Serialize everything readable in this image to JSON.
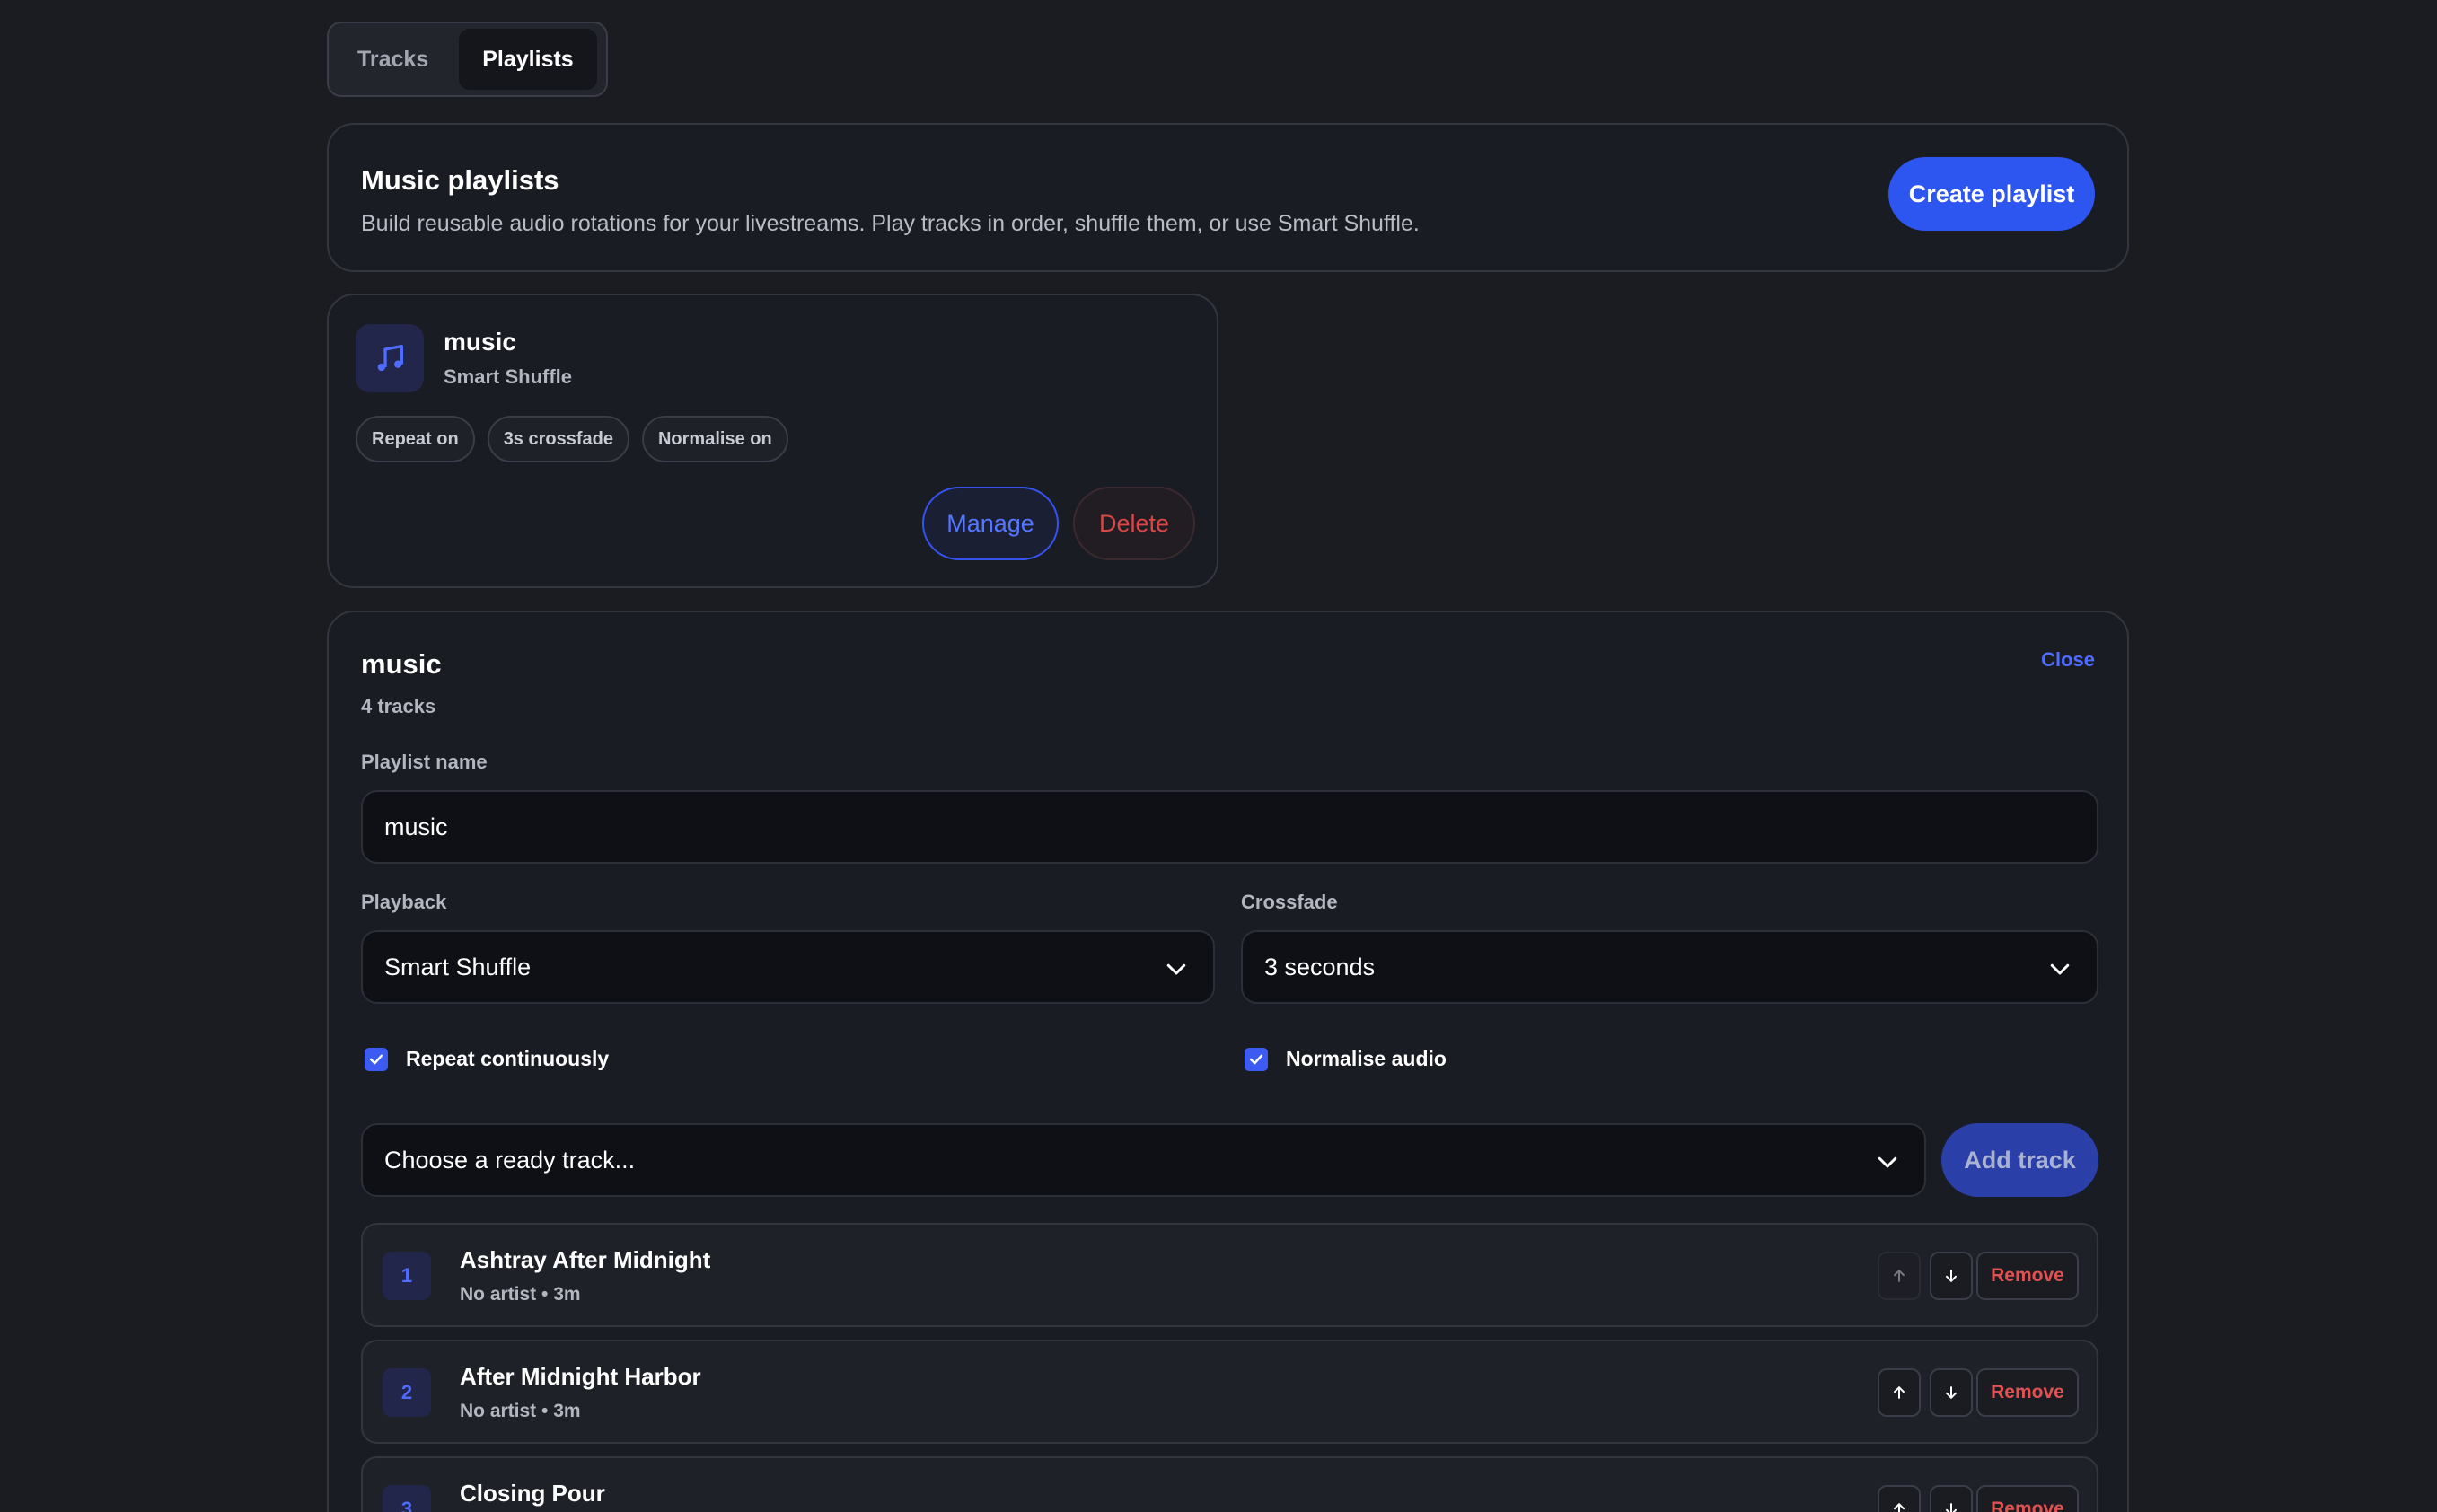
{
  "tabs": [
    {
      "label": "Tracks",
      "active": false
    },
    {
      "label": "Playlists",
      "active": true
    }
  ],
  "header": {
    "title": "Music playlists",
    "subtitle": "Build reusable audio rotations for your livestreams. Play tracks in order, shuffle them, or use Smart Shuffle.",
    "create_label": "Create playlist"
  },
  "playlist_card": {
    "icon": "music-note-icon",
    "name": "music",
    "mode": "Smart Shuffle",
    "chips": [
      "Repeat on",
      "3s crossfade",
      "Normalise on"
    ],
    "manage_label": "Manage",
    "delete_label": "Delete"
  },
  "editor": {
    "title": "music",
    "track_count": "4 tracks",
    "close_label": "Close",
    "name_label": "Playlist name",
    "name_value": "music",
    "playback_label": "Playback",
    "playback_value": "Smart Shuffle",
    "crossfade_label": "Crossfade",
    "crossfade_value": "3 seconds",
    "repeat_label": "Repeat continuously",
    "repeat_checked": true,
    "normalise_label": "Normalise audio",
    "normalise_checked": true,
    "track_select_placeholder": "Choose a ready track...",
    "add_label": "Add track",
    "remove_label": "Remove",
    "tracks": [
      {
        "num": "1",
        "title": "Ashtray After Midnight",
        "meta": "No artist • 3m"
      },
      {
        "num": "2",
        "title": "After Midnight Harbor",
        "meta": "No artist • 3m"
      },
      {
        "num": "3",
        "title": "Closing Pour",
        "meta": ""
      }
    ]
  },
  "colors": {
    "accent": "#2d55f0",
    "danger": "#d94747",
    "background": "#1b1c21"
  }
}
